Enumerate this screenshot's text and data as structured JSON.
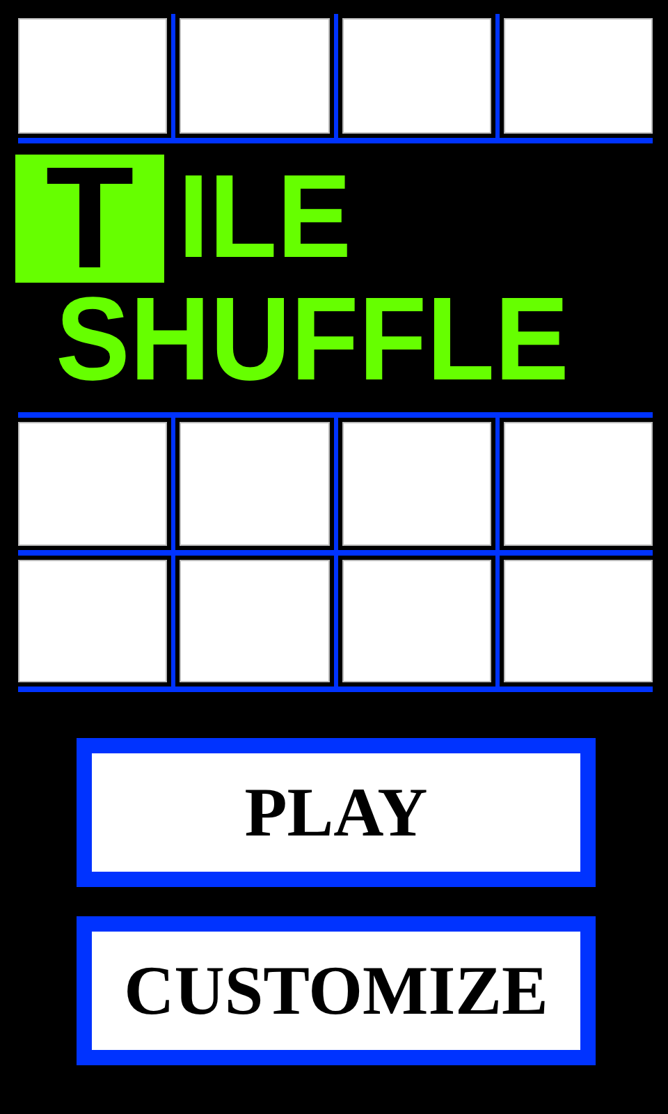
{
  "title": {
    "boxed_letter": "T",
    "first_line_rest": "ILE",
    "second_line": "SHUFFLE"
  },
  "buttons": [
    {
      "label": "PLAY"
    },
    {
      "label": "CUSTOMIZE"
    }
  ]
}
